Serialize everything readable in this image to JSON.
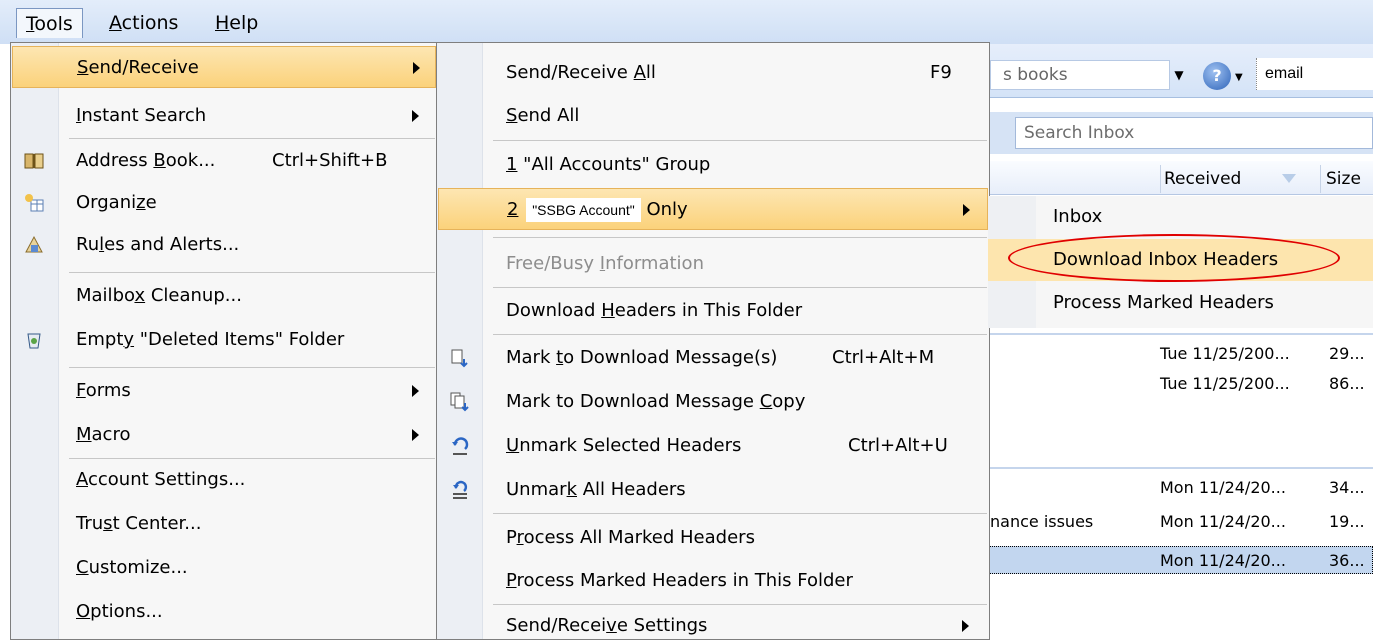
{
  "menubar": {
    "items": [
      {
        "label": "Tools",
        "u": "T",
        "rest": "ools"
      },
      {
        "label": "Actions",
        "u": "A",
        "rest": "ctions"
      },
      {
        "label": "Help",
        "u": "H",
        "rest": "elp"
      }
    ]
  },
  "background": {
    "combo_text": "s books",
    "email_box": "email",
    "search_placeholder": "Search Inbox",
    "col_received": "Received",
    "col_size": "Size",
    "rows": [
      {
        "subject": "",
        "received": "Tue 11/25/200...",
        "size": "29..."
      },
      {
        "subject": "",
        "received": "Tue 11/25/200...",
        "size": "86..."
      },
      {
        "subject": "",
        "received": "Mon 11/24/20...",
        "size": "34..."
      },
      {
        "subject": "nance issues",
        "received": "Mon 11/24/20...",
        "size": "19..."
      },
      {
        "subject": "",
        "received": "Mon 11/24/20...",
        "size": "36..."
      }
    ]
  },
  "tools_menu": {
    "send_receive": {
      "pre": "",
      "u": "S",
      "post": "end/Receive"
    },
    "instant_search": {
      "pre": "",
      "u": "I",
      "post": "nstant Search"
    },
    "address_book": {
      "pre": "Address ",
      "u": "B",
      "post": "ook...",
      "shortcut": "Ctrl+Shift+B"
    },
    "organize": {
      "pre": "Organi",
      "u": "z",
      "post": "e"
    },
    "rules": {
      "pre": "Ru",
      "u": "l",
      "post": "es and Alerts..."
    },
    "mailbox_cleanup": {
      "pre": "Mailbo",
      "u": "x",
      "post": " Cleanup..."
    },
    "empty_deleted": {
      "pre": "Empt",
      "u": "y",
      "post": " \"Deleted Items\" Folder"
    },
    "forms": {
      "pre": "",
      "u": "F",
      "post": "orms"
    },
    "macro": {
      "pre": "",
      "u": "M",
      "post": "acro"
    },
    "account_settings": {
      "pre": "",
      "u": "A",
      "post": "ccount Settings..."
    },
    "trust_center": {
      "pre": "Tru",
      "u": "s",
      "post": "t Center..."
    },
    "customize": {
      "pre": "",
      "u": "C",
      "post": "ustomize..."
    },
    "options": {
      "pre": "",
      "u": "O",
      "post": "ptions..."
    }
  },
  "sr_menu": {
    "send_receive_all": {
      "pre": "Send/Receive ",
      "u": "A",
      "post": "ll",
      "shortcut": "F9"
    },
    "send_all": {
      "pre": "",
      "u": "S",
      "post": "end All"
    },
    "all_accounts": {
      "pre": "",
      "u": "1",
      "post": " \"All Accounts\" Group"
    },
    "account_only": {
      "u": "2",
      "account": "\"SSBG Account\"",
      "post": "Only"
    },
    "free_busy": {
      "pre": "Free/Busy ",
      "u": "I",
      "post": "nformation"
    },
    "download_headers": {
      "pre": "Download ",
      "u": "H",
      "post": "eaders in This Folder"
    },
    "mark_download": {
      "pre": "Mark ",
      "u": "t",
      "post": "o Download Message(s)",
      "shortcut": "Ctrl+Alt+M"
    },
    "mark_copy": {
      "pre": "Mark to Download Message ",
      "u": "C",
      "post": "opy"
    },
    "unmark_selected": {
      "pre": "",
      "u": "U",
      "post": "nmark Selected Headers",
      "shortcut": "Ctrl+Alt+U"
    },
    "unmark_all": {
      "pre": "Unmar",
      "u": "k",
      "post": " All Headers"
    },
    "process_all": {
      "pre": "P",
      "u": "r",
      "post": "ocess All Marked Headers"
    },
    "process_folder": {
      "pre": "",
      "u": "P",
      "post": "rocess Marked Headers in This Folder"
    },
    "settings": {
      "pre": "Send/Recei",
      "u": "v",
      "post": "e Settings"
    }
  },
  "inbox_menu": {
    "inbox": "Inbox",
    "download_inbox_headers": "Download Inbox Headers",
    "process_marked_headers": "Process Marked Headers"
  },
  "colors": {
    "highlight": "#fbd27b",
    "annotation": "#e00000",
    "menubar": "#cfdff5"
  }
}
